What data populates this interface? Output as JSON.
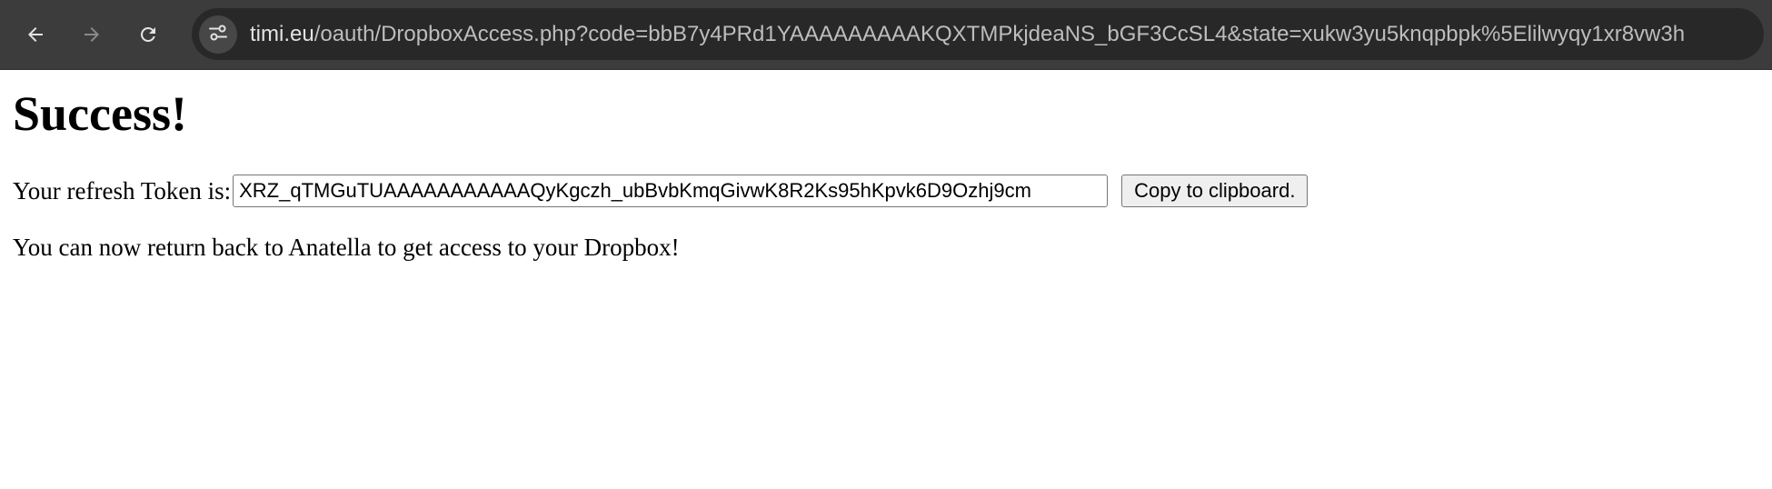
{
  "browser": {
    "url_host": "timi.eu",
    "url_path": "/oauth/DropboxAccess.php?code=bbB7y4PRd1YAAAAAAAAAKQXTMPkjdeaNS_bGF3CcSL4&state=xukw3yu5knqpbpk%5Elilwyqy1xr8vw3h",
    "icons": {
      "back": "back-arrow-icon",
      "forward": "forward-arrow-icon",
      "reload": "reload-icon",
      "site_info": "site-settings-icon"
    }
  },
  "page": {
    "heading": "Success!",
    "token_label": "Your refresh Token is:",
    "token_value": "XRZ_qTMGuTUAAAAAAAAAAAQyKgczh_ubBvbKmqGivwK8R2Ks95hKpvk6D9Ozhj9cm",
    "copy_button_label": "Copy to clipboard.",
    "message": "You can now return back to Anatella to get access to your Dropbox!"
  },
  "colors": {
    "toolbar_bg": "#3c3c3c",
    "omnibox_bg": "#282828",
    "page_bg": "#ffffff"
  }
}
